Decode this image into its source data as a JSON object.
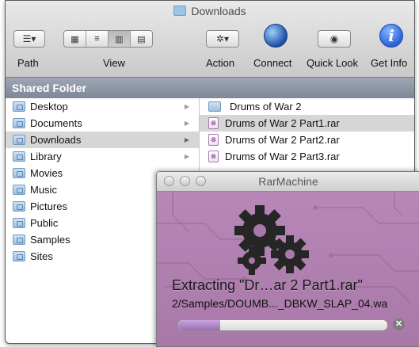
{
  "window": {
    "title": "Downloads"
  },
  "toolbar": {
    "path_label": "Path",
    "view_label": "View",
    "action_label": "Action",
    "connect_label": "Connect",
    "quicklook_label": "Quick Look",
    "getinfo_label": "Get Info",
    "path_glyph": "☰▾",
    "view_glyphs": [
      "▦",
      "≡",
      "▥",
      "▤"
    ],
    "action_glyph": "✲▾",
    "quicklook_glyph": "◉",
    "getinfo_glyph": "i"
  },
  "sidebar": {
    "header": "Shared Folder"
  },
  "column1": {
    "items": [
      {
        "label": "Desktop",
        "icon": "folder-icon",
        "has_arrow": true
      },
      {
        "label": "Documents",
        "icon": "folder-icon",
        "has_arrow": true
      },
      {
        "label": "Downloads",
        "icon": "folder-icon",
        "has_arrow": true,
        "selected": true
      },
      {
        "label": "Library",
        "icon": "folder-icon",
        "has_arrow": true
      },
      {
        "label": "Movies",
        "icon": "folder-icon",
        "has_arrow": false
      },
      {
        "label": "Music",
        "icon": "folder-icon",
        "has_arrow": false
      },
      {
        "label": "Pictures",
        "icon": "folder-icon",
        "has_arrow": false
      },
      {
        "label": "Public",
        "icon": "folder-icon",
        "has_arrow": false
      },
      {
        "label": "Samples",
        "icon": "folder-icon",
        "has_arrow": false
      },
      {
        "label": "Sites",
        "icon": "folder-icon",
        "has_arrow": false
      }
    ],
    "arrow_glyph": "▶"
  },
  "column2": {
    "items": [
      {
        "label": "Drums of War 2",
        "type": "folder"
      },
      {
        "label": "Drums of War 2 Part1.rar",
        "type": "rar",
        "selected": true
      },
      {
        "label": "Drums of War 2 Part2.rar",
        "type": "rar"
      },
      {
        "label": "Drums of War 2 Part3.rar",
        "type": "rar"
      }
    ]
  },
  "dialog": {
    "title": "RarMachine",
    "extracting_text": "Extracting \"Dr…ar 2 Part1.rar\"",
    "path_text": "2/Samples/DOUMB..._DBKW_SLAP_04.wa",
    "progress_percent": 20,
    "cancel_glyph": "✕"
  },
  "colors": {
    "dialog_bg": "#b285b2",
    "sidebar_header": "#8f97a5",
    "selection": "#d6d6d6",
    "progress_fill": "#b08fc8"
  }
}
